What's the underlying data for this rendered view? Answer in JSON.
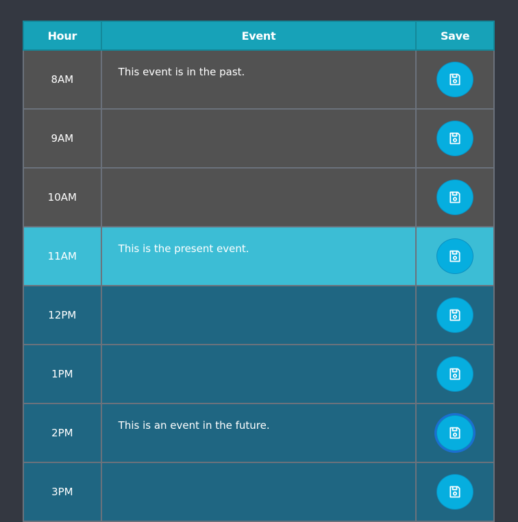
{
  "header": {
    "hour_label": "Hour",
    "event_label": "Event",
    "save_label": "Save"
  },
  "rows": [
    {
      "hour": "8AM",
      "event": "This event is in the past.",
      "state": "past"
    },
    {
      "hour": "9AM",
      "event": "",
      "state": "past"
    },
    {
      "hour": "10AM",
      "event": "",
      "state": "past"
    },
    {
      "hour": "11AM",
      "event": "This is the present event.",
      "state": "present"
    },
    {
      "hour": "12PM",
      "event": "",
      "state": "future"
    },
    {
      "hour": "1PM",
      "event": "",
      "state": "future"
    },
    {
      "hour": "2PM",
      "event": "This is an event in the future.",
      "state": "future",
      "save_focused": true
    },
    {
      "hour": "3PM",
      "event": "",
      "state": "future"
    }
  ],
  "icons": {
    "save": "floppy-disk-icon"
  },
  "colors": {
    "page_background": "#343841",
    "header": "#17a2b8",
    "past": "#525252",
    "present": "#3cbdd5",
    "future": "#1f6682",
    "save_button": "#06aedf"
  }
}
